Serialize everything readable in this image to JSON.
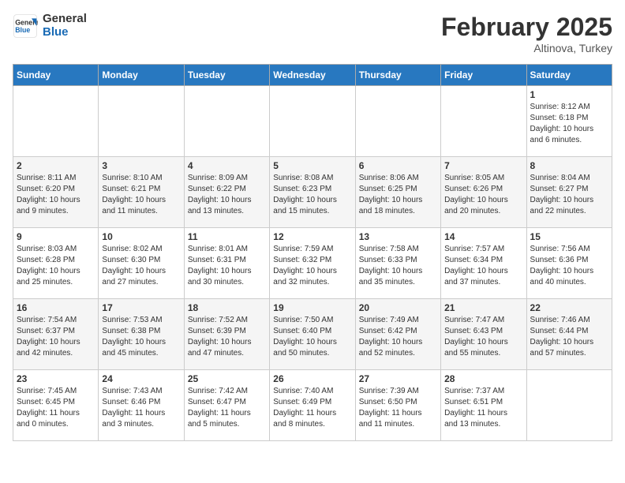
{
  "header": {
    "logo_line1": "General",
    "logo_line2": "Blue",
    "month": "February 2025",
    "location": "Altinova, Turkey"
  },
  "weekdays": [
    "Sunday",
    "Monday",
    "Tuesday",
    "Wednesday",
    "Thursday",
    "Friday",
    "Saturday"
  ],
  "weeks": [
    [
      {
        "day": "",
        "info": ""
      },
      {
        "day": "",
        "info": ""
      },
      {
        "day": "",
        "info": ""
      },
      {
        "day": "",
        "info": ""
      },
      {
        "day": "",
        "info": ""
      },
      {
        "day": "",
        "info": ""
      },
      {
        "day": "1",
        "info": "Sunrise: 8:12 AM\nSunset: 6:18 PM\nDaylight: 10 hours\nand 6 minutes."
      }
    ],
    [
      {
        "day": "2",
        "info": "Sunrise: 8:11 AM\nSunset: 6:20 PM\nDaylight: 10 hours\nand 9 minutes."
      },
      {
        "day": "3",
        "info": "Sunrise: 8:10 AM\nSunset: 6:21 PM\nDaylight: 10 hours\nand 11 minutes."
      },
      {
        "day": "4",
        "info": "Sunrise: 8:09 AM\nSunset: 6:22 PM\nDaylight: 10 hours\nand 13 minutes."
      },
      {
        "day": "5",
        "info": "Sunrise: 8:08 AM\nSunset: 6:23 PM\nDaylight: 10 hours\nand 15 minutes."
      },
      {
        "day": "6",
        "info": "Sunrise: 8:06 AM\nSunset: 6:25 PM\nDaylight: 10 hours\nand 18 minutes."
      },
      {
        "day": "7",
        "info": "Sunrise: 8:05 AM\nSunset: 6:26 PM\nDaylight: 10 hours\nand 20 minutes."
      },
      {
        "day": "8",
        "info": "Sunrise: 8:04 AM\nSunset: 6:27 PM\nDaylight: 10 hours\nand 22 minutes."
      }
    ],
    [
      {
        "day": "9",
        "info": "Sunrise: 8:03 AM\nSunset: 6:28 PM\nDaylight: 10 hours\nand 25 minutes."
      },
      {
        "day": "10",
        "info": "Sunrise: 8:02 AM\nSunset: 6:30 PM\nDaylight: 10 hours\nand 27 minutes."
      },
      {
        "day": "11",
        "info": "Sunrise: 8:01 AM\nSunset: 6:31 PM\nDaylight: 10 hours\nand 30 minutes."
      },
      {
        "day": "12",
        "info": "Sunrise: 7:59 AM\nSunset: 6:32 PM\nDaylight: 10 hours\nand 32 minutes."
      },
      {
        "day": "13",
        "info": "Sunrise: 7:58 AM\nSunset: 6:33 PM\nDaylight: 10 hours\nand 35 minutes."
      },
      {
        "day": "14",
        "info": "Sunrise: 7:57 AM\nSunset: 6:34 PM\nDaylight: 10 hours\nand 37 minutes."
      },
      {
        "day": "15",
        "info": "Sunrise: 7:56 AM\nSunset: 6:36 PM\nDaylight: 10 hours\nand 40 minutes."
      }
    ],
    [
      {
        "day": "16",
        "info": "Sunrise: 7:54 AM\nSunset: 6:37 PM\nDaylight: 10 hours\nand 42 minutes."
      },
      {
        "day": "17",
        "info": "Sunrise: 7:53 AM\nSunset: 6:38 PM\nDaylight: 10 hours\nand 45 minutes."
      },
      {
        "day": "18",
        "info": "Sunrise: 7:52 AM\nSunset: 6:39 PM\nDaylight: 10 hours\nand 47 minutes."
      },
      {
        "day": "19",
        "info": "Sunrise: 7:50 AM\nSunset: 6:40 PM\nDaylight: 10 hours\nand 50 minutes."
      },
      {
        "day": "20",
        "info": "Sunrise: 7:49 AM\nSunset: 6:42 PM\nDaylight: 10 hours\nand 52 minutes."
      },
      {
        "day": "21",
        "info": "Sunrise: 7:47 AM\nSunset: 6:43 PM\nDaylight: 10 hours\nand 55 minutes."
      },
      {
        "day": "22",
        "info": "Sunrise: 7:46 AM\nSunset: 6:44 PM\nDaylight: 10 hours\nand 57 minutes."
      }
    ],
    [
      {
        "day": "23",
        "info": "Sunrise: 7:45 AM\nSunset: 6:45 PM\nDaylight: 11 hours\nand 0 minutes."
      },
      {
        "day": "24",
        "info": "Sunrise: 7:43 AM\nSunset: 6:46 PM\nDaylight: 11 hours\nand 3 minutes."
      },
      {
        "day": "25",
        "info": "Sunrise: 7:42 AM\nSunset: 6:47 PM\nDaylight: 11 hours\nand 5 minutes."
      },
      {
        "day": "26",
        "info": "Sunrise: 7:40 AM\nSunset: 6:49 PM\nDaylight: 11 hours\nand 8 minutes."
      },
      {
        "day": "27",
        "info": "Sunrise: 7:39 AM\nSunset: 6:50 PM\nDaylight: 11 hours\nand 11 minutes."
      },
      {
        "day": "28",
        "info": "Sunrise: 7:37 AM\nSunset: 6:51 PM\nDaylight: 11 hours\nand 13 minutes."
      },
      {
        "day": "",
        "info": ""
      }
    ]
  ]
}
